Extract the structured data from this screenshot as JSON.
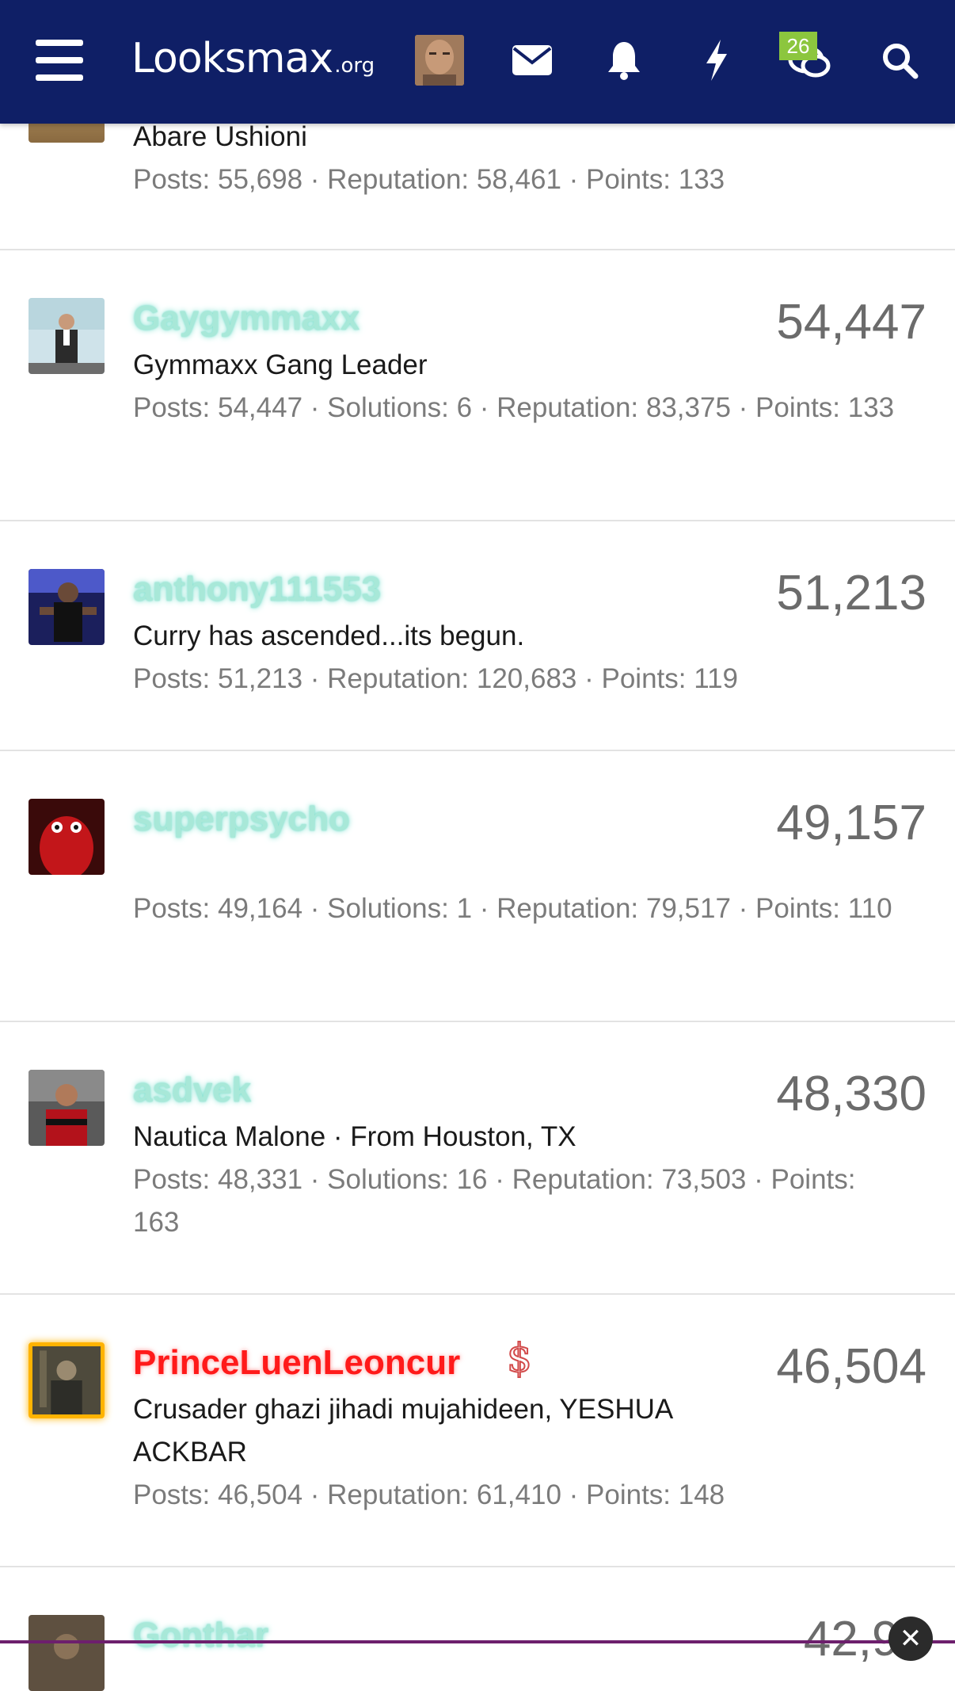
{
  "header": {
    "logo_main": "Looksmax",
    "logo_tld": ".org",
    "conversations_badge": "26",
    "colors": {
      "bg": "#0f1f66",
      "badge": "#8cc63e"
    },
    "icons": [
      "menu-icon",
      "avatar",
      "envelope-icon",
      "bell-icon",
      "bolt-icon",
      "chat-icon",
      "search-icon"
    ]
  },
  "members": [
    {
      "name": "",
      "title": "Abare Ushioni",
      "stats": "Posts: 55,698 · Reputation: 58,461 · Points: 133",
      "count": ""
    },
    {
      "name": "Gaygymmaxx",
      "title": "Gymmaxx Gang Leader",
      "stats": "Posts: 54,447 · Solutions: 6 · Reputation: 83,375 · Points: 133",
      "count": "54,447"
    },
    {
      "name": "anthony111553",
      "title": "Curry has ascended...its begun.",
      "stats": "Posts: 51,213 · Reputation: 120,683 · Points: 119",
      "count": "51,213"
    },
    {
      "name": "superpsycho",
      "title": "",
      "stats": "Posts: 49,164 · Solutions: 1 · Reputation: 79,517 · Points: 110",
      "count": "49,157"
    },
    {
      "name": "asdvek",
      "title": "Nautica Malone · From Houston, TX",
      "stats": "Posts: 48,331 · Solutions: 16 · Reputation: 73,503 · Points: 163",
      "count": "48,330"
    },
    {
      "name": "PrinceLuenLeoncur",
      "title": "Crusader ghazi jihadi mujahideen, YESHUA ACKBAR",
      "stats": "Posts: 46,504 · Reputation: 61,410 · Points: 148",
      "count": "46,504",
      "badge_icon": "$"
    },
    {
      "name": "Gonthar",
      "title": "",
      "stats": "",
      "count": "42,92"
    }
  ]
}
